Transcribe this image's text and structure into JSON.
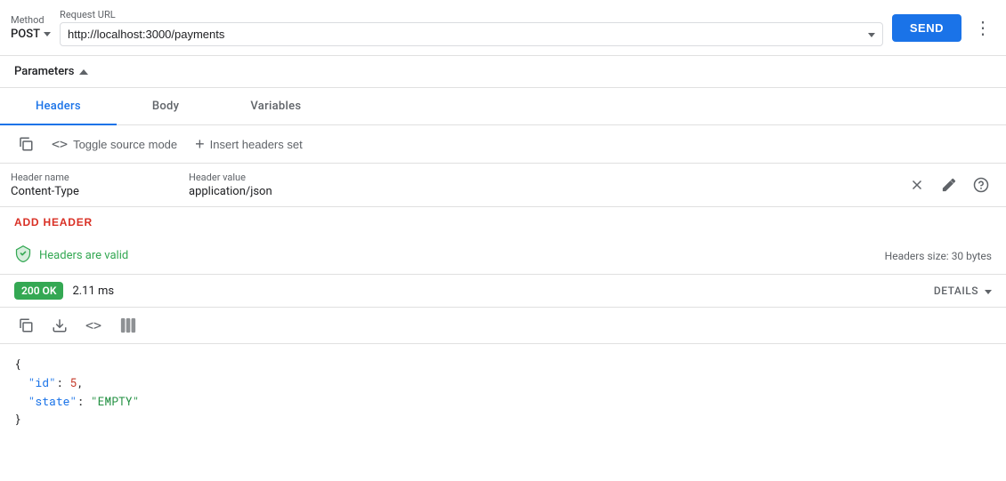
{
  "topbar": {
    "method_label": "Method",
    "method_value": "POST",
    "url_label": "Request URL",
    "url_value": "http://localhost:3000/payments",
    "send_label": "SEND",
    "more_icon": "⋮"
  },
  "params": {
    "label": "Parameters",
    "chevron": "▲"
  },
  "tabs": [
    {
      "id": "headers",
      "label": "Headers",
      "active": true
    },
    {
      "id": "body",
      "label": "Body",
      "active": false
    },
    {
      "id": "variables",
      "label": "Variables",
      "active": false
    }
  ],
  "headers_toolbar": {
    "toggle_label": "Toggle source mode",
    "insert_label": "Insert headers set"
  },
  "header_row": {
    "name_label": "Header name",
    "name_value": "Content-Type",
    "value_label": "Header value",
    "value_value": "application/json"
  },
  "add_header": {
    "label": "ADD HEADER"
  },
  "valid_bar": {
    "valid_text": "Headers are valid",
    "size_text": "Headers size: 30 bytes"
  },
  "status_bar": {
    "status_badge": "200 OK",
    "response_time": "2.11 ms",
    "details_label": "DETAILS"
  },
  "json_response": {
    "lines": [
      {
        "text": "{",
        "type": "brace"
      },
      {
        "text": "  \"id\": 5,",
        "key": "id",
        "value": "5",
        "type": "num"
      },
      {
        "text": "  \"state\": \"EMPTY\"",
        "key": "state",
        "value": "EMPTY",
        "type": "str"
      },
      {
        "text": "}",
        "type": "brace"
      }
    ]
  }
}
